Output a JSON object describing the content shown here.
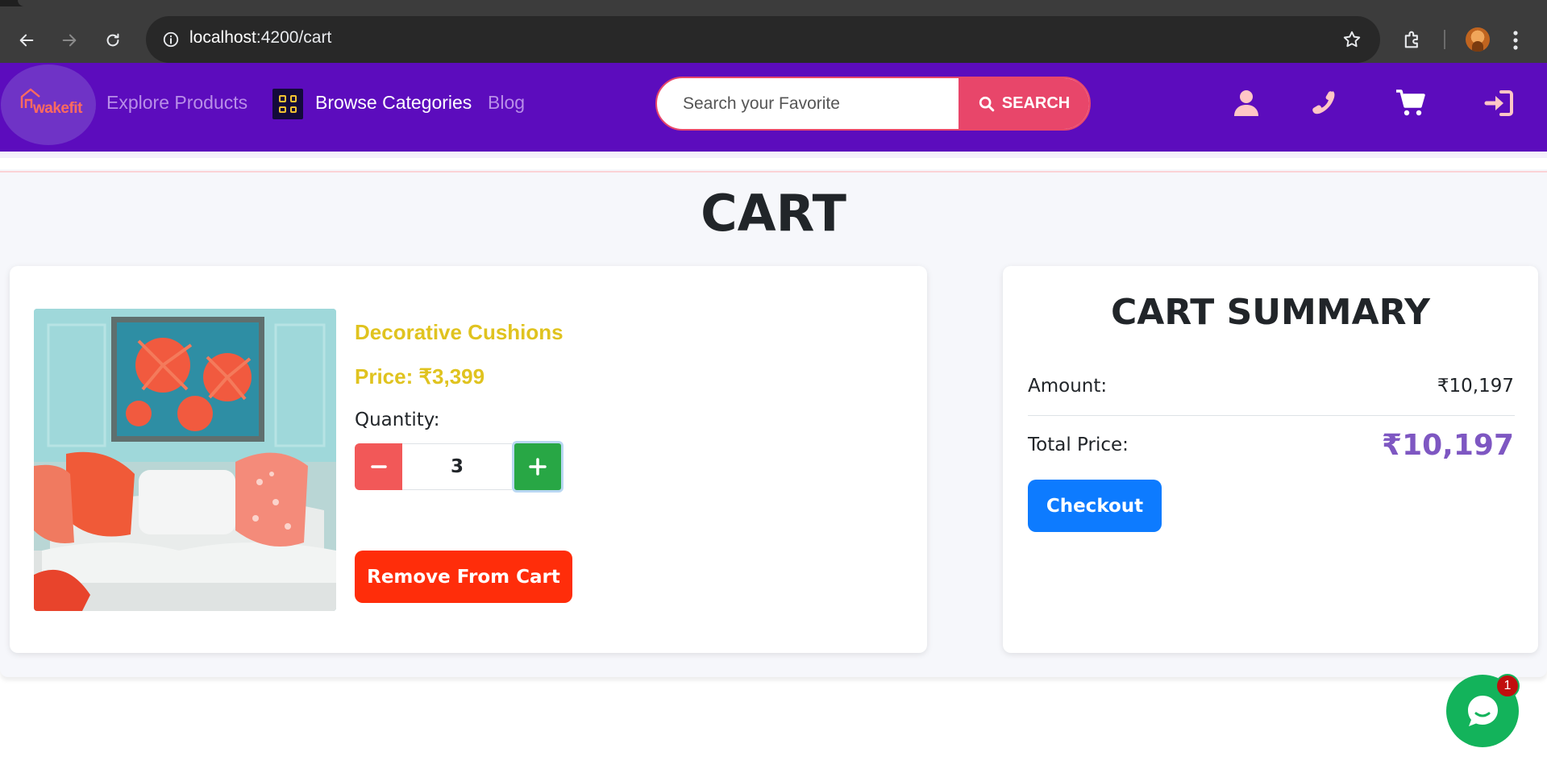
{
  "browser": {
    "url_host": "localhost",
    "url_path": ":4200/cart"
  },
  "navbar": {
    "logo_text": "wakefit",
    "links": {
      "explore": "Explore Products",
      "categories": "Browse Categories",
      "blog": "Blog"
    },
    "search": {
      "placeholder": "Search your Favorite",
      "button_label": "SEARCH"
    },
    "icons": [
      "user-icon",
      "phone-icon",
      "cart-icon",
      "login-icon"
    ],
    "colors": {
      "background": "#5c0cbd",
      "search_accent": "#e8466a"
    }
  },
  "page": {
    "title": "CART"
  },
  "cart": {
    "items": [
      {
        "name": "Decorative Cushions",
        "price_label": "Price: ₹3,399",
        "quantity_label": "Quantity:",
        "quantity": "3",
        "remove_label": "Remove From Cart"
      }
    ]
  },
  "summary": {
    "title": "CART SUMMARY",
    "amount_label": "Amount:",
    "amount_value": "₹10,197",
    "total_label": "Total Price:",
    "total_value": "₹10,197",
    "checkout_label": "Checkout"
  },
  "chat": {
    "badge_count": "1"
  }
}
